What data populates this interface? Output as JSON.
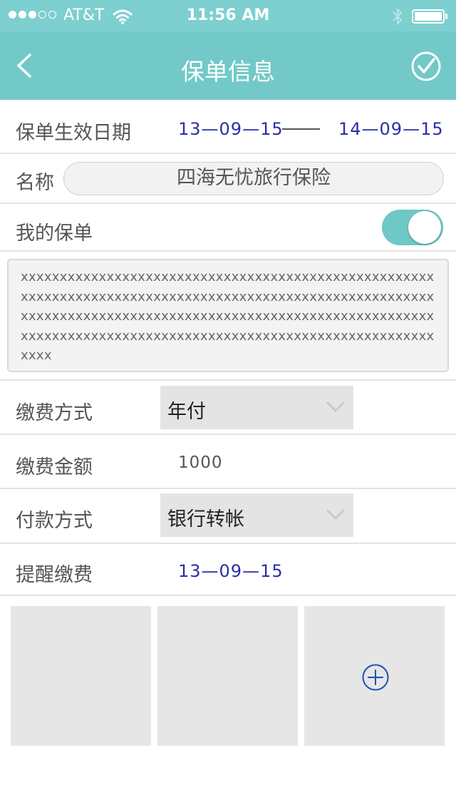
{
  "status_bar": {
    "carrier": "AT&T",
    "time": "11:56 AM",
    "signal_icon": "signal-dots-icon",
    "wifi_icon": "wifi-icon",
    "bluetooth_icon": "bluetooth-icon",
    "battery_icon": "battery-icon",
    "battery_level": 1.0
  },
  "nav": {
    "title": "保单信息",
    "back_icon": "chevron-left-icon",
    "done_icon": "check-circle-icon"
  },
  "form": {
    "effective_date": {
      "label": "保单生效日期",
      "start": "13—09—15",
      "end": "14—09—15"
    },
    "name": {
      "label": "名称",
      "value": "四海无忧旅行保险"
    },
    "my_policy": {
      "label": "我的保单",
      "enabled": true
    },
    "description": "xxxxxxxxxxxxxxxxxxxxxxxxxxxxxxxxxxxxxxxxxxxxxxxxxxxxxxxxxxxxxxxxxxxxxxxxxxxxxxxxxxxxxxxxxxxxxxxxxxxxxxxxxxxxxxxxxxxxxxxxxxxxxxxxxxxxxxxxxxxxxxxxxxxxxxxxxxxxxxxxxxxxxxxxxxxxxxxxxxxxxxxxxxxxxxxxxxxxxxxxxxxxxxxxxxxxxxxx",
    "payment_frequency": {
      "label": "缴费方式",
      "value": "年付"
    },
    "payment_amount": {
      "label": "缴费金额",
      "value": "1000"
    },
    "payment_method": {
      "label": "付款方式",
      "value": "银行转帐"
    },
    "payment_reminder": {
      "label": "提醒缴费",
      "date": "13—09—15"
    }
  },
  "attachments": {
    "add_icon": "plus-circle-icon",
    "slots": 3
  },
  "colors": {
    "accent": "#72c9c8",
    "status_bar": "#7ecfcf",
    "date_text": "#2b2fa6",
    "add_icon": "#1f4fb0"
  }
}
